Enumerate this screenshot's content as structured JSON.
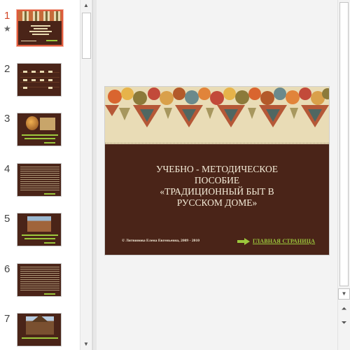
{
  "thumbnails": [
    {
      "number": "1",
      "has_animation": true,
      "selected": true
    },
    {
      "number": "2",
      "has_animation": false,
      "selected": false
    },
    {
      "number": "3",
      "has_animation": false,
      "selected": false
    },
    {
      "number": "4",
      "has_animation": false,
      "selected": false
    },
    {
      "number": "5",
      "has_animation": false,
      "selected": false
    },
    {
      "number": "6",
      "has_animation": false,
      "selected": false
    },
    {
      "number": "7",
      "has_animation": false,
      "selected": false
    }
  ],
  "current_slide": {
    "title_lines": [
      "УЧЕБНО - МЕТОДИЧЕСКОЕ",
      "ПОСОБИЕ",
      "«ТРАДИЦИОННЫЙ БЫТ В",
      "РУССКОМ ДОМЕ»"
    ],
    "author": "© Литвинова Елена Евгеньевна, 2009 - 2010",
    "link_label": "ГЛАВНАЯ  СТРАНИЦА"
  },
  "colors": {
    "slide_background": "#4a2418",
    "banner": "#e9dcb6",
    "link": "#9cc83c",
    "selection": "#e05a3c"
  },
  "icons": {
    "animation_marker": "star-icon",
    "scroll_up": "chevron-up-icon",
    "scroll_down": "chevron-down-icon",
    "previous_slide": "double-chevron-up-icon",
    "next_slide": "double-chevron-down-icon",
    "link_arrow": "arrow-right-icon"
  }
}
